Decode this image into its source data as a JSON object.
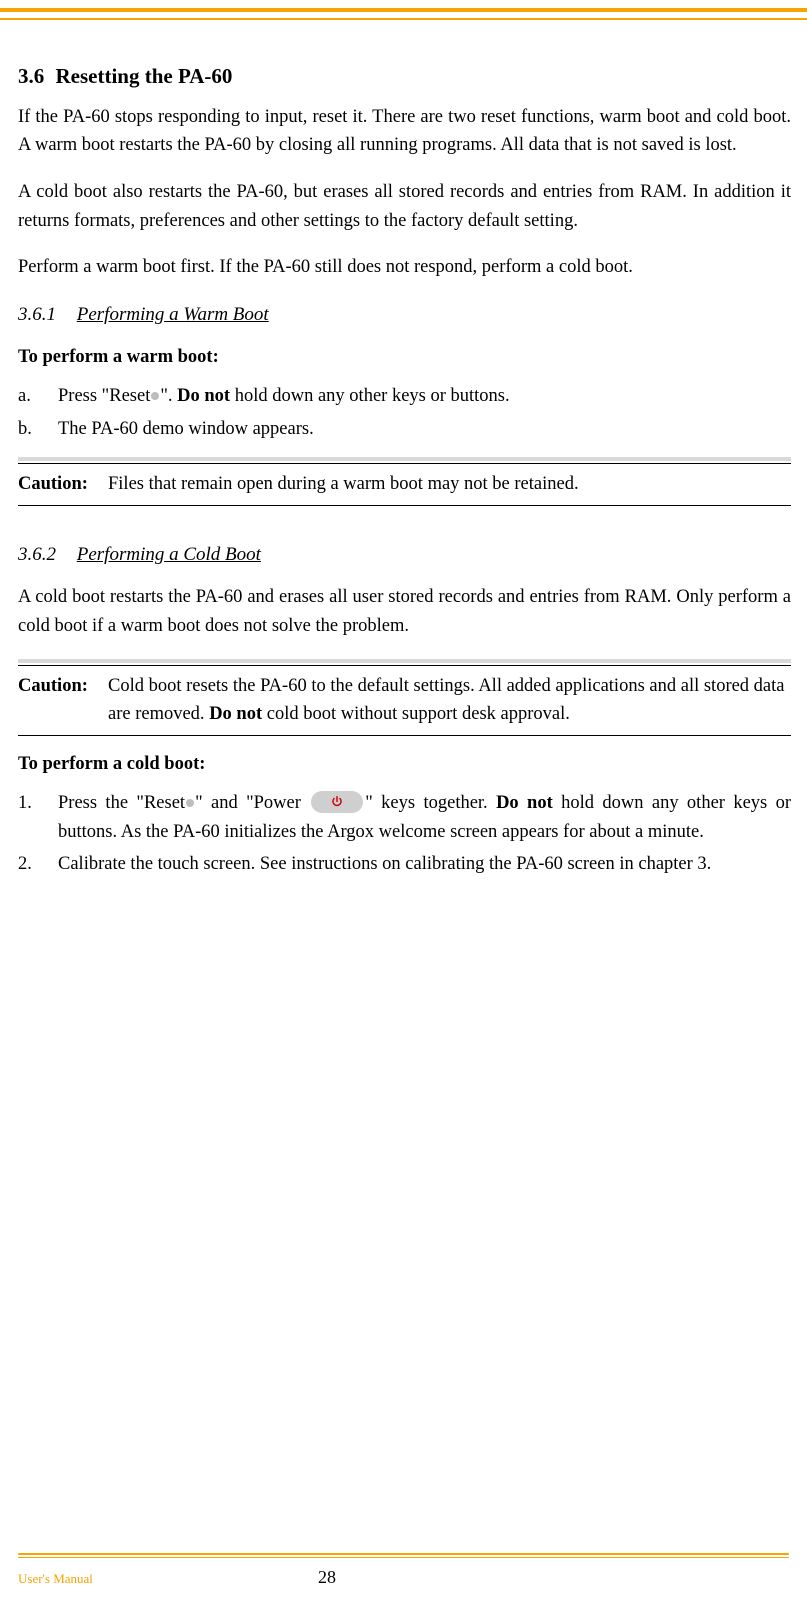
{
  "header": {
    "section_number": "3.6",
    "section_title": "Resetting the PA-60"
  },
  "intro": {
    "p1": "If the PA-60 stops responding to input, reset it. There are two reset functions, warm boot and cold boot. A warm boot restarts the PA-60 by closing all running programs. All data that is not saved is lost.",
    "p2": "A cold boot also restarts the PA-60, but erases all stored records and entries from RAM. In addition it returns formats, preferences and other settings to the factory default setting.",
    "p3": "Perform a warm boot first. If the PA-60 still does not respond, perform a cold boot."
  },
  "warm": {
    "num": "3.6.1",
    "title": "Performing a Warm Boot",
    "lead": "To perform a warm boot:",
    "items": [
      {
        "marker": "a.",
        "before": "Press \"Reset",
        "after": "\". ",
        "emph": "Do not",
        "tail": " hold down any other keys or buttons."
      },
      {
        "marker": "b.",
        "text": "The PA-60 demo window appears."
      }
    ],
    "caution_label": "Caution:",
    "caution_text": "Files that remain open during a warm boot may not be retained."
  },
  "cold": {
    "num": "3.6.2",
    "title": "Performing a Cold Boot",
    "intro": "A cold boot restarts the PA-60 and erases all user stored records and entries from RAM. Only perform a cold boot if a warm boot does not solve the problem.",
    "caution_label": "Caution:",
    "caution_text_a": "Cold boot resets the PA-60 to the default settings. All added applications and all stored data are removed. ",
    "caution_emph": "Do not",
    "caution_text_b": " cold boot without support desk approval.",
    "lead": "To perform a cold boot:",
    "items": [
      {
        "marker": "1.",
        "pre": "Press the \"Reset",
        "mid_a": "\" and \"Power ",
        "mid_b": "\" keys together. ",
        "emph": "Do not",
        "tail": " hold down any other keys or buttons. As the PA-60 initializes the Argox welcome screen appears for about a minute."
      },
      {
        "marker": "2.",
        "text": "Calibrate the touch screen. See instructions on calibrating the PA-60 screen in chapter 3."
      }
    ]
  },
  "footer": {
    "label": "User's Manual",
    "page": "28"
  }
}
